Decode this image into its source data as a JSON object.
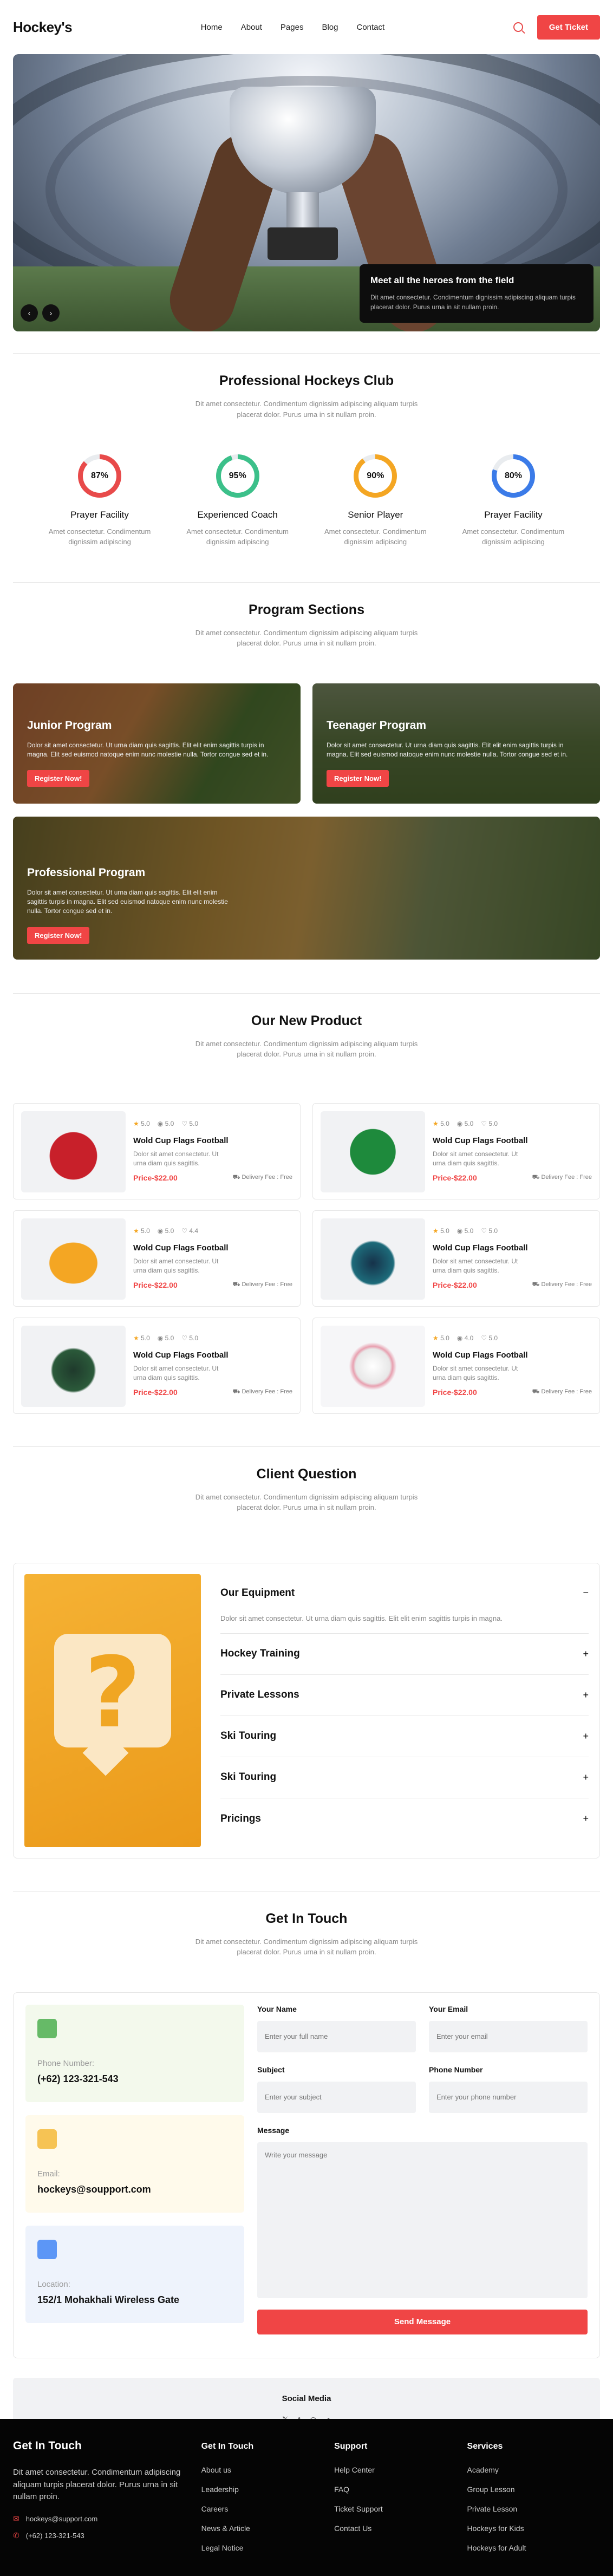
{
  "nav": {
    "logo": "Hockey's",
    "links": [
      "Home",
      "About",
      "Pages",
      "Blog",
      "Contact"
    ],
    "cta": "Get Ticket"
  },
  "hero": {
    "card_title": "Meet all the heroes from the field",
    "card_text": "Dit amet consectetur. Condimentum dignissim adipiscing aliquam turpis placerat dolor. Purus urna in sit nullam proin.",
    "prev": "‹",
    "next": "›"
  },
  "club": {
    "title": "Professional Hockeys Club",
    "subtitle": "Dit amet consectetur. Condimentum dignissim adipiscing aliquam turpis placerat dolor. Purus urna in sit nullam proin.",
    "stats": [
      {
        "value": "87%",
        "percent": 87,
        "color": "#e84a4a",
        "label": "Prayer Facility",
        "text": "Amet consectetur. Condimentum dignissim adipiscing"
      },
      {
        "value": "95%",
        "percent": 95,
        "color": "#3cc08a",
        "label": "Experienced Coach",
        "text": "Amet consectetur. Condimentum dignissim adipiscing"
      },
      {
        "value": "90%",
        "percent": 90,
        "color": "#f4a623",
        "label": "Senior Player",
        "text": "Amet consectetur. Condimentum dignissim adipiscing"
      },
      {
        "value": "80%",
        "percent": 80,
        "color": "#3b7be8",
        "label": "Prayer Facility",
        "text": "Amet consectetur. Condimentum dignissim adipiscing"
      }
    ]
  },
  "programs": {
    "title": "Program Sections",
    "subtitle": "Dit amet consectetur. Condimentum dignissim adipiscing aliquam turpis placerat dolor. Purus urna in sit nullam proin.",
    "items": [
      {
        "title": "Junior Program",
        "text": "Dolor sit amet consectetur. Ut urna diam quis sagittis. Elit elit enim sagittis turpis in magna. Elit sed euismod natoque enim nunc molestie nulla. Tortor congue sed et in.",
        "button": "Register Now!"
      },
      {
        "title": "Teenager Program",
        "text": "Dolor sit amet consectetur. Ut urna diam quis sagittis. Elit elit enim sagittis turpis in magna. Elit sed euismod natoque enim nunc molestie nulla. Tortor congue sed et in.",
        "button": "Register Now!"
      },
      {
        "title": "Professional Program",
        "text": "Dolor sit amet consectetur. Ut urna diam quis sagittis. Elit elit enim sagittis turpis in magna. Elit sed euismod natoque enim nunc molestie nulla. Tortor congue sed et in.",
        "button": "Register Now!"
      }
    ]
  },
  "products": {
    "title": "Our New Product",
    "subtitle": "Dit amet consectetur. Condimentum dignissim adipiscing aliquam turpis placerat dolor. Purus urna in sit nullam proin.",
    "items": [
      {
        "rating": "5.0",
        "views": "5.0",
        "likes": "5.0",
        "name": "Wold Cup Flags Football",
        "desc": "Dolor sit amet consectetur. Ut urna diam quis sagittis.",
        "price": "Price-$22.00",
        "delivery": "Delivery Fee : Free",
        "icon": "jacket-icon"
      },
      {
        "rating": "5.0",
        "views": "5.0",
        "likes": "5.0",
        "name": "Wold Cup Flags Football",
        "desc": "Dolor sit amet consectetur. Ut urna diam quis sagittis.",
        "price": "Price-$22.00",
        "delivery": "Delivery Fee : Free",
        "icon": "ball-icon"
      },
      {
        "rating": "5.0",
        "views": "5.0",
        "likes": "4.4",
        "name": "Wold Cup Flags Football",
        "desc": "Dolor sit amet consectetur. Ut urna diam quis sagittis.",
        "price": "Price-$22.00",
        "delivery": "Delivery Fee : Free",
        "icon": "cap-icon"
      },
      {
        "rating": "5.0",
        "views": "5.0",
        "likes": "5.0",
        "name": "Wold Cup Flags Football",
        "desc": "Dolor sit amet consectetur. Ut urna diam quis sagittis.",
        "price": "Price-$22.00",
        "delivery": "Delivery Fee : Free",
        "icon": "jersey-icon"
      },
      {
        "rating": "5.0",
        "views": "5.0",
        "likes": "5.0",
        "name": "Wold Cup Flags Football",
        "desc": "Dolor sit amet consectetur. Ut urna diam quis sagittis.",
        "price": "Price-$22.00",
        "delivery": "Delivery Fee : Free",
        "icon": "helmet-icon"
      },
      {
        "rating": "5.0",
        "views": "4.0",
        "likes": "5.0",
        "name": "Wold Cup Flags Football",
        "desc": "Dolor sit amet consectetur. Ut urna diam quis sagittis.",
        "price": "Price-$22.00",
        "delivery": "Delivery Fee : Free",
        "icon": "soccer-ball-icon"
      }
    ]
  },
  "faq": {
    "title": "Client Question",
    "subtitle": "Dit amet consectetur. Condimentum dignissim adipiscing aliquam turpis placerat dolor. Purus urna in sit nullam proin.",
    "open": {
      "question": "Our Equipment",
      "answer": "Dolor sit amet consectetur. Ut urna diam quis sagittis. Elit elit enim sagittis turpis in magna.",
      "sign": "−"
    },
    "items": [
      {
        "question": "Hockey Training",
        "sign": "+"
      },
      {
        "question": "Private Lessons",
        "sign": "+"
      },
      {
        "question": "Ski Touring",
        "sign": "+"
      },
      {
        "question": "Ski Touring",
        "sign": "+"
      },
      {
        "question": "Pricings",
        "sign": "+"
      }
    ]
  },
  "contact": {
    "title": "Get In Touch",
    "subtitle": "Dit amet consectetur. Condimentum dignissim adipiscing aliquam turpis placerat dolor. Purus urna in sit nullam proin.",
    "cards": [
      {
        "label": "Phone Number:",
        "value": "(+62) 123-321-543",
        "bg": "#f3f9ec",
        "icon": "phone-icon",
        "icon_color": "#4caf50"
      },
      {
        "label": "Email:",
        "value": "hockeys@soupport.com",
        "bg": "#fffaeb",
        "icon": "mail-icon",
        "icon_color": "#f4b93a"
      },
      {
        "label": "Location:",
        "value": "152/1 Mohakhali Wireless Gate",
        "bg": "#eef3fc",
        "icon": "location-pin-icon",
        "icon_color": "#4285f4"
      }
    ],
    "form": {
      "name_label": "Your Name",
      "name_ph": "Enter your full name",
      "email_label": "Your Email",
      "email_ph": "Enter your email",
      "subject_label": "Subject",
      "subject_ph": "Enter your subject",
      "phone_label": "Phone Number",
      "phone_ph": "Enter your phone number",
      "message_label": "Message",
      "message_ph": "Write your message",
      "submit": "Send Message"
    }
  },
  "social": {
    "title": "Social Media",
    "icons": [
      "twitter-icon",
      "facebook-icon",
      "instagram-icon",
      "github-icon"
    ],
    "glyphs": [
      "𝕏",
      "f",
      "◎",
      "●"
    ]
  },
  "footer": {
    "title": "Get In Touch",
    "text": "Dit amet consectetur. Condimentum adipiscing aliquam turpis placerat dolor. Purus urna in sit nullam proin.",
    "email": "hockeys@support.com",
    "phone": "(+62) 123-321-543",
    "columns": [
      {
        "title": "Get In Touch",
        "links": [
          "About us",
          "Leadership",
          "Careers",
          "News & Article",
          "Legal Notice"
        ]
      },
      {
        "title": "Support",
        "links": [
          "Help Center",
          "FAQ",
          "Ticket Support",
          "Contact Us"
        ]
      },
      {
        "title": "Services",
        "links": [
          "Academy",
          "Group Lesson",
          "Private Lesson",
          "Hockeys for Kids",
          "Hockeys for Adult"
        ]
      }
    ]
  }
}
